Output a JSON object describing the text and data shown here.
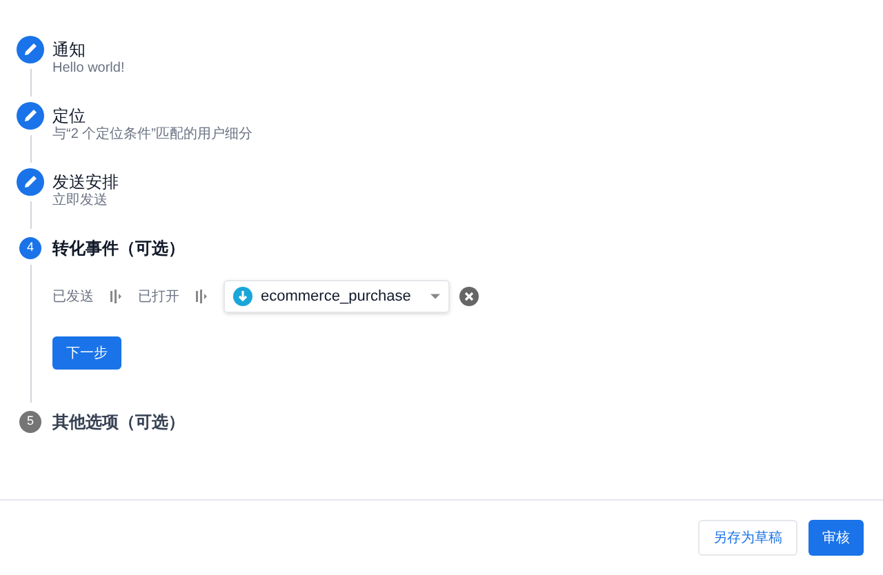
{
  "steps": [
    {
      "completed": true,
      "active": false,
      "title": "通知",
      "subtitle": "Hello world!"
    },
    {
      "completed": true,
      "active": false,
      "title": "定位",
      "subtitle": "与“2 个定位条件”匹配的用户细分"
    },
    {
      "completed": true,
      "active": false,
      "title": "发送安排",
      "subtitle": "立即发送"
    },
    {
      "completed": false,
      "active": true,
      "number": "4",
      "title": "转化事件（可选）",
      "funnel": [
        {
          "label": "已发送"
        },
        {
          "label": "已打开"
        }
      ],
      "event": {
        "value": "ecommerce_purchase"
      },
      "next_button": "下一步"
    },
    {
      "completed": false,
      "active": false,
      "number": "5",
      "title": "其他选项（可选）"
    }
  ],
  "footer": {
    "buttons": [
      {
        "label": "另存为草稿",
        "kind": "secondary"
      },
      {
        "label": "审核",
        "kind": "primary"
      }
    ]
  }
}
